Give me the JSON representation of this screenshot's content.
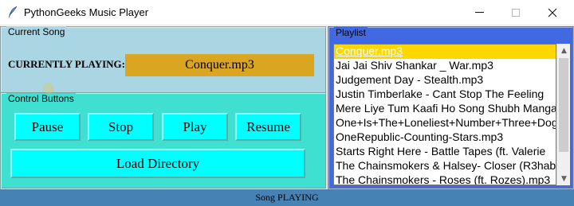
{
  "window": {
    "title": "PythonGeeks Music Player",
    "icon": "feather-icon",
    "controls": [
      "minimize-icon",
      "maximize-icon",
      "close-icon"
    ]
  },
  "current_song": {
    "frame_title": "Current Song",
    "label": "CURRENTLY PLAYING:",
    "song": "Conquer.mp3"
  },
  "controls": {
    "frame_title": "Control Buttons",
    "pause": "Pause",
    "stop": "Stop",
    "play": "Play",
    "resume": "Resume",
    "load_directory": "Load Directory"
  },
  "playlist": {
    "frame_title": "Playlist",
    "selected_index": 0,
    "items": [
      "Conquer.mp3",
      "Jai Jai Shiv Shankar _ War.mp3",
      "Judgement Day - Stealth.mp3",
      "Justin Timberlake - Cant Stop The Feeling",
      "Mere Liye Tum Kaafi Ho Song Shubh Mangal",
      "One+Is+The+Loneliest+Number+Three+Dog",
      "OneRepublic-Counting-Stars.mp3",
      "Starts Right Here - Battle Tapes (ft. Valerie",
      "The Chainsmokers & Halsey- Closer (R3hab",
      "The Chainsmokers - Roses (ft. Rozes).mp3"
    ]
  },
  "status": "Song PLAYING",
  "colors": {
    "current_song_bg": "#a9d6e2",
    "controls_bg": "#40e0d0",
    "playlist_bg": "#4169e1",
    "song_box_bg": "#daa520",
    "button_bg": "#00ffff",
    "selected_bg": "#ffd700",
    "status_bg": "#4682b4"
  }
}
